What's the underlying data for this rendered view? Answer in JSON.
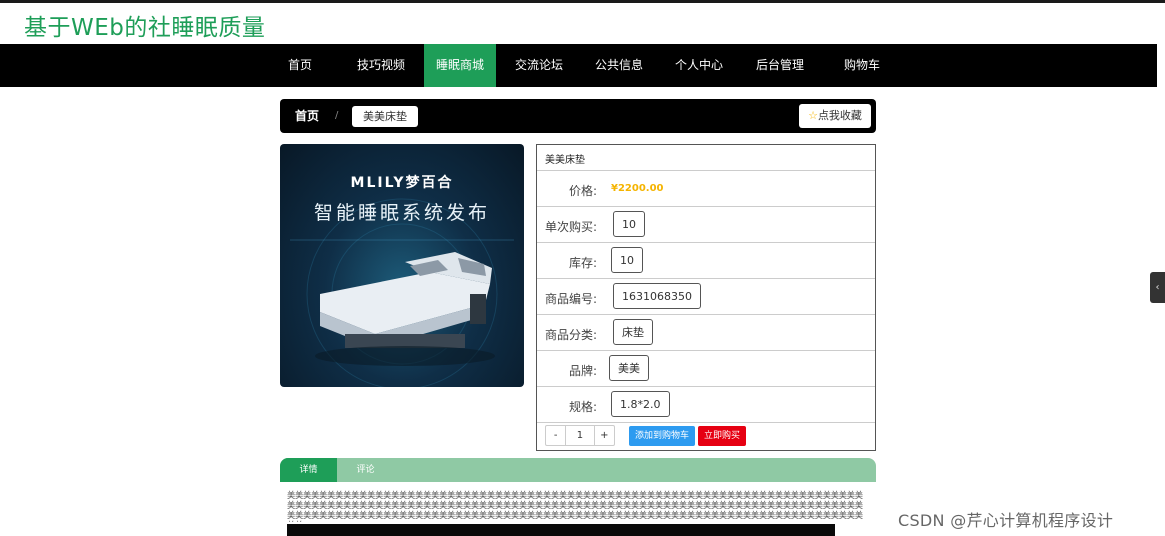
{
  "site": {
    "title": "基于WEb的社睡眠质量"
  },
  "nav": [
    {
      "label": "首页",
      "active": false
    },
    {
      "label": "技巧视频",
      "active": false
    },
    {
      "label": "睡眠商城",
      "active": true
    },
    {
      "label": "交流论坛",
      "active": false
    },
    {
      "label": "公共信息",
      "active": false
    },
    {
      "label": "个人中心",
      "active": false
    },
    {
      "label": "后台管理",
      "active": false
    },
    {
      "label": "购物车",
      "active": false
    }
  ],
  "breadcrumb": {
    "home": "首页",
    "separator": "/",
    "current": "美美床垫"
  },
  "favorite": {
    "label": "点我收藏"
  },
  "image": {
    "brand": "MLILY梦百合",
    "headline": "智能睡眠系统发布"
  },
  "product": {
    "name": "美美床垫",
    "price_label": "价格:",
    "price": "¥2200.00",
    "rows": [
      {
        "label": "单次购买:",
        "value": "10"
      },
      {
        "label": "库存:",
        "value": "10"
      },
      {
        "label": "商品编号:",
        "value": "1631068350"
      },
      {
        "label": "商品分类:",
        "value": "床垫"
      },
      {
        "label": "品牌:",
        "value": "美美"
      },
      {
        "label": "规格:",
        "value": "1.8*2.0"
      }
    ]
  },
  "purchase": {
    "minus": "-",
    "quantity": "1",
    "plus": "+",
    "add_cart": "添加到购物车",
    "buy_now": "立即购买"
  },
  "tabs": {
    "detail": "详情",
    "comments": "评论"
  },
  "detail": {
    "text": "美美美美美美美美美美美美美美美美美美美美美美美美美美美美美美美美美美美美美美美美美美美美美美美美美美美美美美美美美美美美美美美美美美美美美美美美美美美美美美美美美美美美美美美美美美美美美美美美美美美美美美美美美美美美美美美美美美美美美美美美美美美美美美美美美美美美美美美美美美美美美美美美美美美美美美美美美美美美美美美美美美美美美美美美美美美美美美美美美美美美美美美美美美美美美美美美美美美美美美美美美美美美美美美美美美美美美美美美美美"
  },
  "watermark": {
    "text": "CSDN @芹心计算机程序设计"
  }
}
